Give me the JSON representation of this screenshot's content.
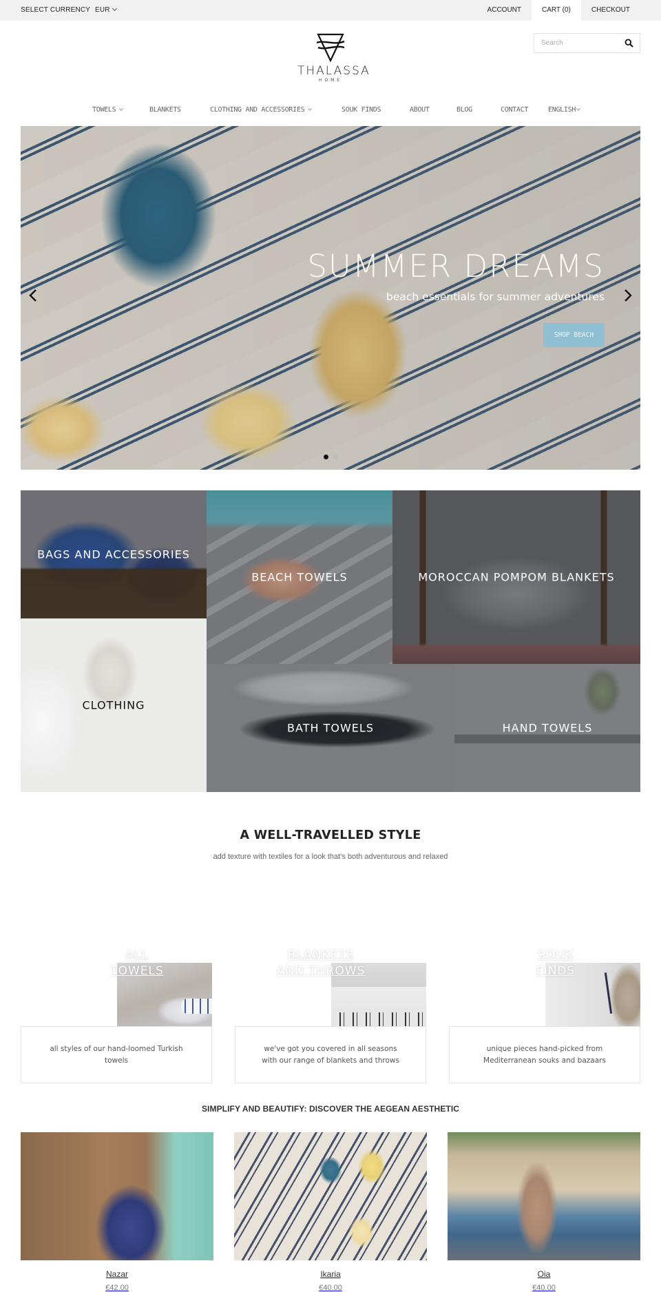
{
  "topbar": {
    "currency_label": "SELECT CURRENCY",
    "currency_value": "EUR",
    "links": {
      "account": "ACCOUNT",
      "cart": "CART (0)",
      "checkout": "CHECKOUT"
    }
  },
  "header": {
    "brand": "THALASSA",
    "brand_sub": "HOME",
    "search_placeholder": "Search"
  },
  "nav": {
    "items": [
      {
        "label": "TOWELS",
        "dropdown": true
      },
      {
        "label": "BLANKETS",
        "dropdown": false
      },
      {
        "label": "CLOTHING AND ACCESSORIES",
        "dropdown": true
      },
      {
        "label": "SOUK FINDS",
        "dropdown": false
      },
      {
        "label": "ABOUT",
        "dropdown": false
      },
      {
        "label": "BLOG",
        "dropdown": false
      },
      {
        "label": "CONTACT",
        "dropdown": false
      },
      {
        "label": "ENGLISH",
        "dropdown": true
      }
    ]
  },
  "hero": {
    "title": "SUMMER DREAMS",
    "tagline": "beach essentials for summer adventures",
    "cta": "SHOP BEACH",
    "slide_count": 2,
    "active_slide": 1,
    "colors": {
      "cta_bg": "#8ebfd3",
      "dot_active": "#111111",
      "dot_inactive": "#bdbdbd"
    }
  },
  "categories": [
    {
      "label": "BAGS AND ACCESSORIES"
    },
    {
      "label": "BEACH TOWELS"
    },
    {
      "label": "MOROCCAN POMPOM BLANKETS"
    },
    {
      "label": "CLOTHING"
    },
    {
      "label": "BATH TOWELS"
    },
    {
      "label": "HAND TOWELS"
    }
  ],
  "well_travelled": {
    "title": "A WELL-TRAVELLED STYLE",
    "subtitle": "add texture with textiles for a look that's both adventurous and relaxed"
  },
  "features": [
    {
      "title_line1": "ALL",
      "title_line2": "TOWELS",
      "description": "all styles of our hand-loomed Turkish towels"
    },
    {
      "title_line1": "BLANKETS",
      "title_line2": "AND THROWS",
      "description": "we've got you covered in all seasons with our range of blankets and throws"
    },
    {
      "title_line1": "SOUK",
      "title_line2": "FINDS",
      "description": "unique pieces hand-picked from Mediterranean souks and bazaars"
    }
  ],
  "aegean": {
    "title": "SIMPLIFY AND BEAUTIFY: DISCOVER THE AEGEAN AESTHETIC",
    "products": [
      {
        "name": "Nazar",
        "price": "€42.00"
      },
      {
        "name": "Ikaria",
        "price": "€40.00"
      },
      {
        "name": "Oia",
        "price": "€40.00"
      }
    ]
  }
}
